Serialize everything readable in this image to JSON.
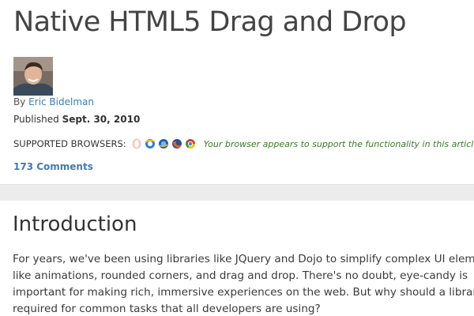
{
  "article": {
    "title": "Native HTML5 Drag and Drop",
    "by_prefix": "By",
    "author": "Eric Bidelman",
    "published_prefix": "Published",
    "published_date": "Sept. 30, 2010",
    "supported_label": "Supported browsers:",
    "browser_icons": [
      "opera-icon",
      "ie-icon",
      "ie-alt-icon",
      "firefox-icon",
      "chrome-icon"
    ],
    "support_note": "Your browser appears to support the functionality in this article.",
    "comments": "173 Comments"
  },
  "section": {
    "heading": "Introduction",
    "paragraph_lines": [
      "For years, we've been using libraries like JQuery and Dojo to simplify complex UI elements",
      "like animations, rounded corners, and drag and drop. There's no doubt, eye-candy is",
      "important for making rich, immersive experiences on the web. But why should a library be",
      "required for common tasks that all developers are using?"
    ]
  },
  "colors": {
    "link": "#3f7cb0",
    "support_note": "#3b7a2a",
    "band": "#ececec"
  }
}
